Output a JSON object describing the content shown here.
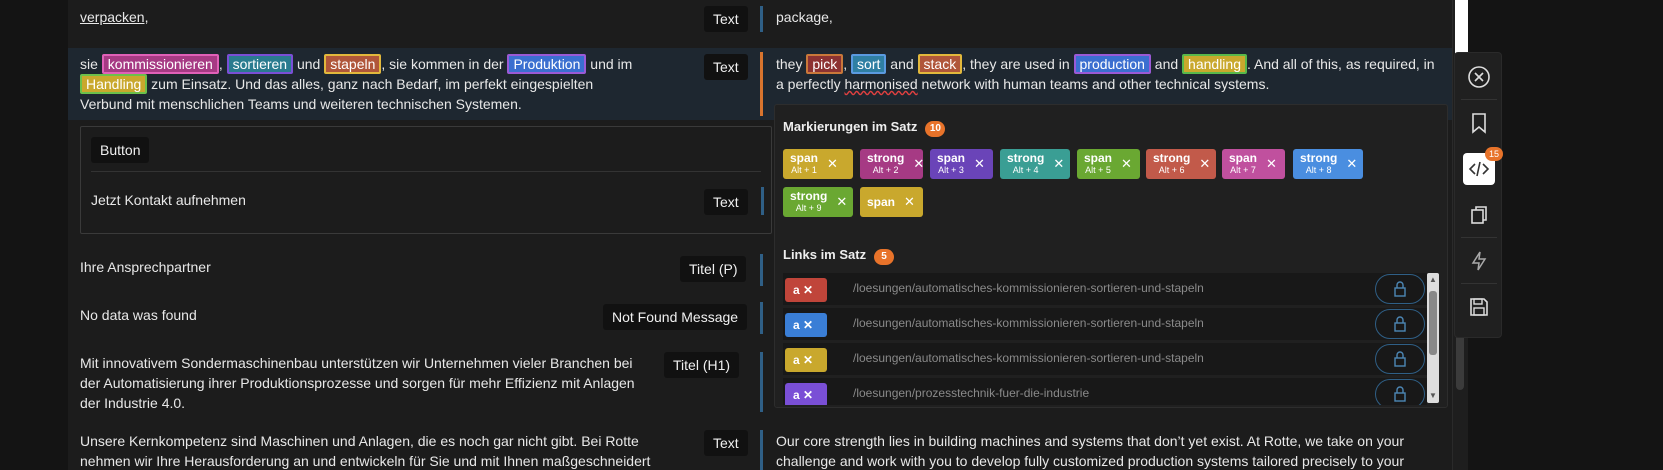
{
  "rows": {
    "r1": {
      "src": "verpacken,",
      "tag": "Text",
      "trg": "package,"
    },
    "r2": {
      "src_a": "sie",
      "src_b": "kommissionieren",
      "src_c": ",",
      "src_d": "sortieren",
      "src_e": "und",
      "src_f": "stapeln",
      "src_g": ", sie kommen in der",
      "src_h": "Produktion",
      "src_i": "und im",
      "src_j": "Handling",
      "src_k": "zum Einsatz. Und das alles, ganz nach Bedarf, im perfekt eingespielten Verbund mit menschlichen Teams und weiteren technischen Systemen.",
      "tag": "Text",
      "trg_a": "they",
      "trg_b": "pick",
      "trg_c": ",",
      "trg_d": "sort",
      "trg_e": "and",
      "trg_f": "stack",
      "trg_g": ", they are used in",
      "trg_h": "production",
      "trg_i": "and",
      "trg_j": "handling",
      "trg_k": ". And all of this, as required, in a perfectly",
      "trg_l": "harmonised",
      "trg_m": "network with human teams and other technical systems."
    },
    "button_group": {
      "label": "Button",
      "src": "Jetzt Kontakt aufnehmen",
      "tag": "Text"
    },
    "r3": {
      "src": "Ihre Ansprechpartner",
      "tag": "Titel (P)"
    },
    "r4": {
      "src": "No data was found",
      "tag": "Not Found Message"
    },
    "r5": {
      "src": "Mit innovativem Sondermaschinenbau unterstützen wir Unternehmen vieler Branchen bei der Automatisierung ihrer Produktionsprozesse und sorgen für mehr Effizienz mit Anlagen der Industrie 4.0.",
      "tag": "Titel (H1)"
    },
    "r6": {
      "src": "Unsere Kernkompetenz sind Maschinen und Anlagen, die es noch gar nicht gibt. Bei Rotte nehmen wir Ihre Herausforderung an und entwickeln für Sie und mit Ihnen maßgeschneidert genau die",
      "tag": "Text",
      "trg": "Our core strength lies in building machines and systems that don’t yet exist. At Rotte, we take on your challenge and work with you to develop fully customized production systems tailored precisely to your"
    }
  },
  "popup": {
    "marks_title": "Markierungen im Satz",
    "marks_count": "10",
    "chips": [
      {
        "tag": "span",
        "key": "Alt + 1",
        "color": "#c9a82d"
      },
      {
        "tag": "strong",
        "key": "Alt + 2",
        "color": "#a63a84"
      },
      {
        "tag": "span",
        "key": "Alt + 3",
        "color": "#6a44b8"
      },
      {
        "tag": "strong",
        "key": "Alt + 4",
        "color": "#3a9e94"
      },
      {
        "tag": "span",
        "key": "Alt + 5",
        "color": "#6aa832"
      },
      {
        "tag": "strong",
        "key": "Alt + 6",
        "color": "#c25a4a"
      },
      {
        "tag": "span",
        "key": "Alt + 7",
        "color": "#c0509e"
      },
      {
        "tag": "strong",
        "key": "Alt + 8",
        "color": "#4a8ee0"
      },
      {
        "tag": "strong",
        "key": "Alt + 9",
        "color": "#6aa832"
      },
      {
        "tag": "span",
        "key": "",
        "color": "#c9a82d"
      }
    ],
    "links_title": "Links im Satz",
    "links_count": "5",
    "links": [
      {
        "tag": "a",
        "color": "#c0453a",
        "path": "/loesungen/automatisches-kommissionieren-sortieren-und-stapeln"
      },
      {
        "tag": "a",
        "color": "#3a7ed6",
        "path": "/loesungen/automatisches-kommissionieren-sortieren-und-stapeln"
      },
      {
        "tag": "a",
        "color": "#c9a82d",
        "path": "/loesungen/automatisches-kommissionieren-sortieren-und-stapeln"
      },
      {
        "tag": "a",
        "color": "#7a4fd6",
        "path": "/loesungen/prozesstechnik-fuer-die-industrie"
      }
    ]
  },
  "toolbar": {
    "code_badge": "15"
  },
  "icons": {
    "close": "close-icon",
    "bookmark": "bookmark-icon",
    "code": "code-icon",
    "copy": "copy-icon",
    "bolt": "lightning-icon",
    "save": "save-icon",
    "lock": "lock-icon"
  }
}
